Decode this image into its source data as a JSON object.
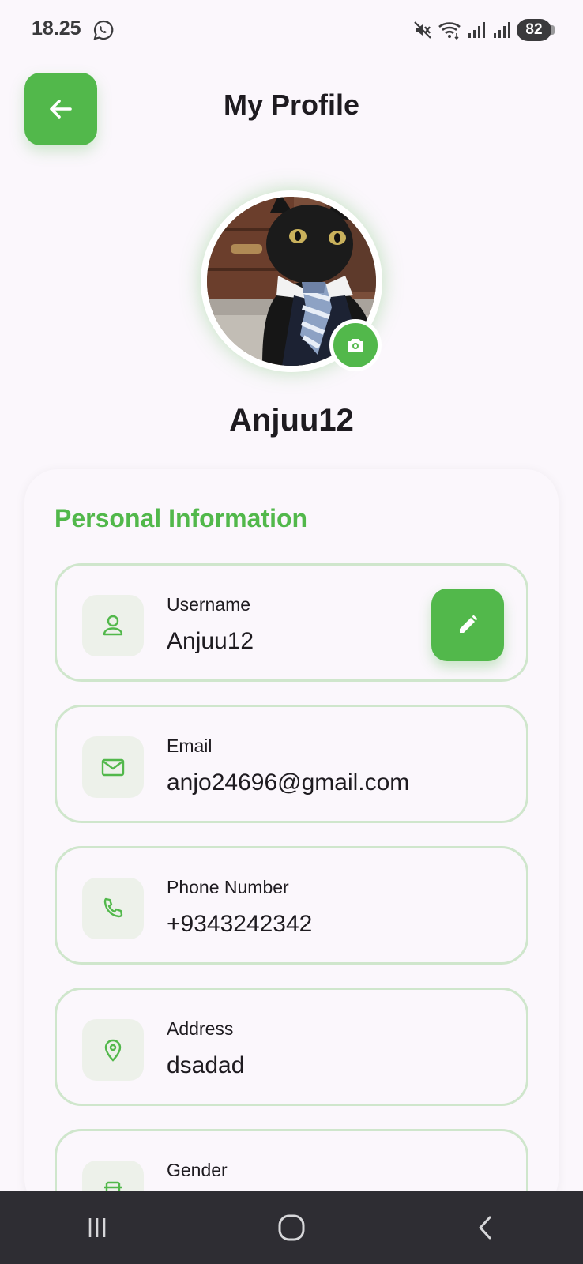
{
  "status_bar": {
    "time": "18.25",
    "battery": "82",
    "icons": [
      "whatsapp-icon",
      "mute-icon",
      "wifi-icon",
      "signal-icon",
      "signal-icon"
    ]
  },
  "header": {
    "title": "My Profile",
    "back_icon": "arrow-left-icon"
  },
  "profile": {
    "name": "Anjuu12",
    "avatar": "cat-in-suit-photo",
    "camera_icon": "camera-icon"
  },
  "personal_info": {
    "title": "Personal Information",
    "fields": [
      {
        "label": "Username",
        "value": "Anjuu12",
        "icon": "person-icon"
      },
      {
        "label": "Email",
        "value": "anjo24696@gmail.com",
        "icon": "mail-icon"
      },
      {
        "label": "Phone Number",
        "value": "+9343242342",
        "icon": "phone-icon"
      },
      {
        "label": "Address",
        "value": "dsadad",
        "icon": "location-pin-icon"
      },
      {
        "label": "Gender",
        "value": "",
        "icon": "gender-icon"
      }
    ]
  },
  "nav_bar": {
    "items": [
      "recent-apps-icon",
      "home-icon",
      "back-icon"
    ]
  },
  "colors": {
    "accent": "#52B84B",
    "background": "#FBF7FC",
    "field_border": "#CFE6CC",
    "icon_box": "#EDF1EA",
    "text": "#1E1B20",
    "nav_bar": "#2E2D33"
  }
}
